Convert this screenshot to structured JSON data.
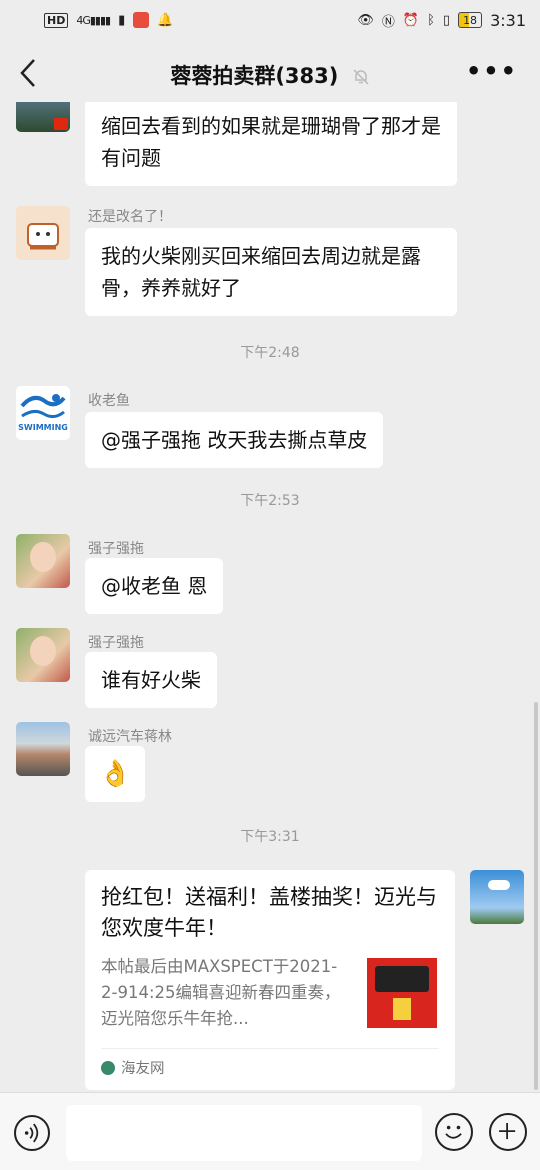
{
  "status_bar": {
    "hd": "HD",
    "signal": "4G",
    "battery": "18",
    "time": "3:31"
  },
  "header": {
    "title": "蓉蓉拍卖群(383)"
  },
  "messages": [
    {
      "sender": "",
      "text": "缩回去看到的如果就是珊瑚骨了那才是有问题"
    },
    {
      "sender": "还是改名了！",
      "text": "我的火柴刚买回来缩回去周边就是露骨，养养就好了"
    },
    {
      "time": "下午2:48"
    },
    {
      "sender": "收老鱼",
      "text": "@强子强拖  改天我去撕点草皮",
      "avatar_text": "SWIMMING"
    },
    {
      "time": "下午2:53"
    },
    {
      "sender": "强子强拖",
      "text": "@收老鱼  恩"
    },
    {
      "sender": "强子强拖",
      "text": "谁有好火柴"
    },
    {
      "sender": "诚远汽车蒋林",
      "text": "👌"
    },
    {
      "time": "下午3:31"
    }
  ],
  "card": {
    "title": "抢红包！送福利！盖楼抽奖！迈光与您欢度牛年！",
    "desc": "本帖最后由MAXSPECT于2021-2-914:25编辑喜迎新春四重奏，迈光陪您乐牛年抢...",
    "source": "海友网"
  },
  "input": {
    "placeholder": ""
  }
}
